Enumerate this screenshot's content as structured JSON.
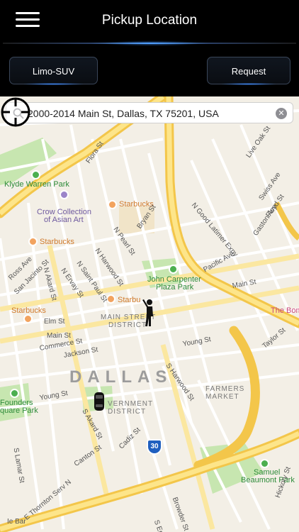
{
  "header": {
    "title": "Pickup Location",
    "vehicle_button": "Limo-SUV",
    "request_button": "Request"
  },
  "search": {
    "address": "2000-2014 Main St, Dallas, TX 75201, USA"
  },
  "map": {
    "city": "DALLAS",
    "interstate": "30",
    "parks": {
      "klyde": "Klyde Warren Park",
      "carpenter_1": "John Carpenter",
      "carpenter_2": "Plaza Park",
      "founders_1": "Founders",
      "founders_2": "quare Park",
      "samuel_1": "Samuel",
      "samuel_2": "Beaumont Park"
    },
    "places": {
      "crow_1": "Crow Collection",
      "crow_2": "of Asian Art",
      "starbucks": "Starbucks",
      "starbucks_short": "Starbu",
      "the_bomb": "The Bom"
    },
    "districts": {
      "main_street_1": "MAIN STREET",
      "main_street_2": "DISTRICT",
      "government_1": "VERNMENT",
      "government_2": "DISTRICT",
      "farmers_1": "FARMERS",
      "farmers_2": "MARKET"
    },
    "streets": {
      "flora": "Flora St",
      "live_oak": "Live Oak St",
      "swiss": "Swiss Ave",
      "floyd": "Floyd St",
      "gaston": "Gaston Ave",
      "good_latimer": "N Good Latimer Expy",
      "bryan": "Bryan St",
      "n_pearl": "N Pearl St",
      "pacific": "Pacific Ave",
      "n_harwood": "N Harwood St",
      "n_st_paul": "N Saint Paul St",
      "n_ervay": "N Ervay St",
      "n_akard": "N Akard St",
      "ross": "Ross Ave",
      "san_jacinto": "San Jacinto St",
      "main": "Main St",
      "main_right": "Main St",
      "elm": "Elm St",
      "commerce": "Commerce St",
      "jackson": "Jackson St",
      "young": "Young St",
      "young_left": "Young St",
      "taylor": "Taylor St",
      "s_harwood": "S Harwood St",
      "s_akard": "S Akard St",
      "cadiz": "Cadiz St",
      "canton": "Canton St",
      "s_lamar": "S Lamar St",
      "thornton": "E Thornton Serv N",
      "browder": "Browder St",
      "hickory": "Hickory St",
      "s_ervay": "S Ervay St",
      "ie_bar": "Ie Bar"
    }
  },
  "colors": {
    "header_bg": "#000000",
    "accent_glow": "#3f8bff",
    "highway": "#f7d23c",
    "park": "#bfe3a4"
  }
}
